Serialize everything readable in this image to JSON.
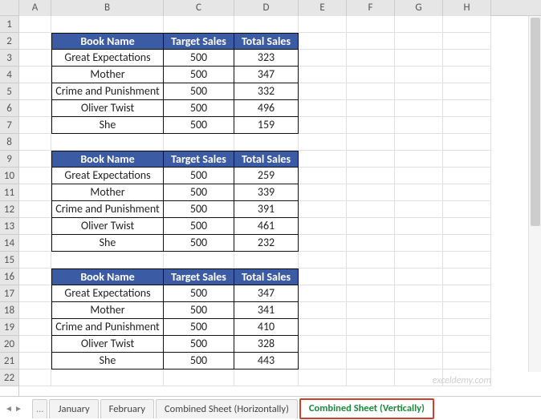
{
  "columns": [
    "A",
    "B",
    "C",
    "D",
    "E",
    "F",
    "G",
    "H"
  ],
  "rows": [
    "1",
    "2",
    "3",
    "4",
    "5",
    "6",
    "7",
    "8",
    "9",
    "10",
    "11",
    "12",
    "13",
    "14",
    "15",
    "16",
    "17",
    "18",
    "19",
    "20",
    "21",
    "22"
  ],
  "tables": [
    {
      "header": {
        "book": "Book Name",
        "target": "Target Sales",
        "total": "Total Sales"
      },
      "rows": [
        {
          "book": "Great Expectations",
          "target": "500",
          "total": "323"
        },
        {
          "book": "Mother",
          "target": "500",
          "total": "347"
        },
        {
          "book": "Crime and Punishment",
          "target": "500",
          "total": "332"
        },
        {
          "book": "Oliver Twist",
          "target": "500",
          "total": "496"
        },
        {
          "book": "She",
          "target": "500",
          "total": "159"
        }
      ]
    },
    {
      "header": {
        "book": "Book Name",
        "target": "Target Sales",
        "total": "Total Sales"
      },
      "rows": [
        {
          "book": "Great Expectations",
          "target": "500",
          "total": "259"
        },
        {
          "book": "Mother",
          "target": "500",
          "total": "339"
        },
        {
          "book": "Crime and Punishment",
          "target": "500",
          "total": "391"
        },
        {
          "book": "Oliver Twist",
          "target": "500",
          "total": "461"
        },
        {
          "book": "She",
          "target": "500",
          "total": "232"
        }
      ]
    },
    {
      "header": {
        "book": "Book Name",
        "target": "Target Sales",
        "total": "Total Sales"
      },
      "rows": [
        {
          "book": "Great Expectations",
          "target": "500",
          "total": "347"
        },
        {
          "book": "Mother",
          "target": "500",
          "total": "341"
        },
        {
          "book": "Crime and Punishment",
          "target": "500",
          "total": "410"
        },
        {
          "book": "Oliver Twist",
          "target": "500",
          "total": "328"
        },
        {
          "book": "She",
          "target": "500",
          "total": "443"
        }
      ]
    }
  ],
  "tabs": {
    "ellipsis": "...",
    "january": "January",
    "february": "February",
    "horizontal": "Combined Sheet (Horizontally)",
    "vertical": "Combined Sheet (Vertically)"
  },
  "watermark": "exceldemy.com"
}
